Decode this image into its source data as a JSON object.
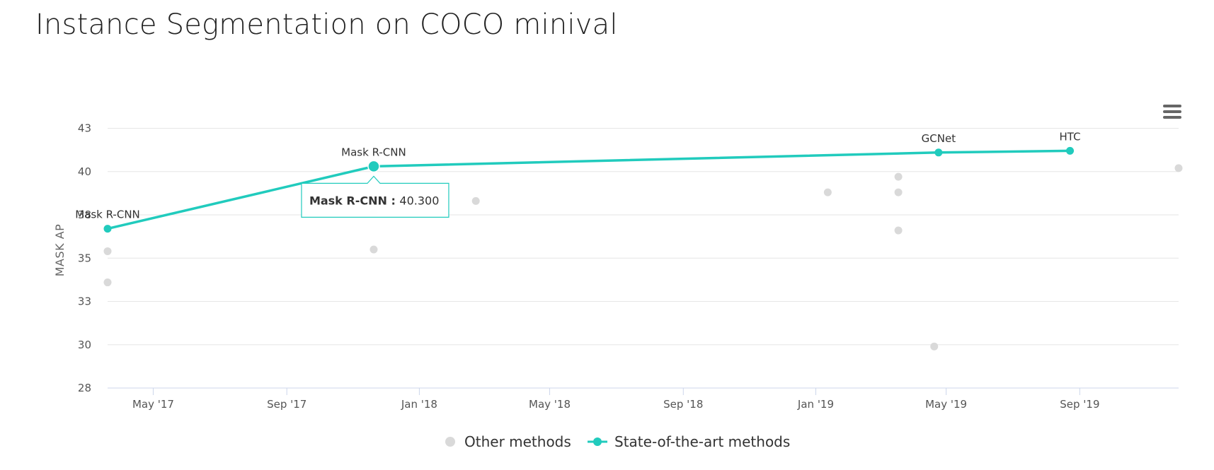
{
  "page": {
    "title": "Instance Segmentation on COCO minival"
  },
  "chart_data": {
    "type": "scatter",
    "title": "",
    "xlabel": "",
    "ylabel": "MASK AP",
    "x_axis": {
      "kind": "date",
      "range": [
        "2017-03-20",
        "2019-12-01"
      ],
      "ticks": [
        {
          "date": "2017-05-01",
          "label": "May '17"
        },
        {
          "date": "2017-09-01",
          "label": "Sep '17"
        },
        {
          "date": "2018-01-01",
          "label": "Jan '18"
        },
        {
          "date": "2018-05-01",
          "label": "May '18"
        },
        {
          "date": "2018-09-01",
          "label": "Sep '18"
        },
        {
          "date": "2019-01-01",
          "label": "Jan '19"
        },
        {
          "date": "2019-05-01",
          "label": "May '19"
        },
        {
          "date": "2019-09-01",
          "label": "Sep '19"
        }
      ]
    },
    "y_axis": {
      "range": [
        27.5,
        43.5
      ],
      "ticks": [
        {
          "value": 27.5,
          "label": "28"
        },
        {
          "value": 30,
          "label": "30"
        },
        {
          "value": 32.5,
          "label": "33"
        },
        {
          "value": 35,
          "label": "35"
        },
        {
          "value": 37.5,
          "label": "38"
        },
        {
          "value": 40,
          "label": "40"
        },
        {
          "value": 42.5,
          "label": "43"
        }
      ]
    },
    "grid": true,
    "legend_position": "bottom-center",
    "series": [
      {
        "name": "Other methods",
        "type": "scatter",
        "color": "#d9d9d9",
        "points": [
          {
            "x": "2017-03-20",
            "y": 35.4
          },
          {
            "x": "2017-03-20",
            "y": 33.6
          },
          {
            "x": "2017-11-20",
            "y": 37.6
          },
          {
            "x": "2017-11-20",
            "y": 35.5
          },
          {
            "x": "2018-02-22",
            "y": 38.3
          },
          {
            "x": "2019-01-12",
            "y": 38.8
          },
          {
            "x": "2019-03-18",
            "y": 39.7
          },
          {
            "x": "2019-03-18",
            "y": 38.8
          },
          {
            "x": "2019-03-18",
            "y": 36.6
          },
          {
            "x": "2019-04-20",
            "y": 29.9
          },
          {
            "x": "2019-12-01",
            "y": 40.2
          }
        ]
      },
      {
        "name": "State-of-the-art methods",
        "type": "line",
        "color": "#21cbbd",
        "points": [
          {
            "x": "2017-03-20",
            "y": 36.7,
            "label": "Mask R-CNN"
          },
          {
            "x": "2017-11-20",
            "y": 40.3,
            "label": "Mask R-CNN"
          },
          {
            "x": "2019-04-24",
            "y": 41.1,
            "label": "GCNet"
          },
          {
            "x": "2019-08-23",
            "y": 41.2,
            "label": "HTC"
          }
        ]
      }
    ],
    "tooltip": {
      "name": "Mask R-CNN",
      "separator": " : ",
      "value": "40.300"
    }
  }
}
